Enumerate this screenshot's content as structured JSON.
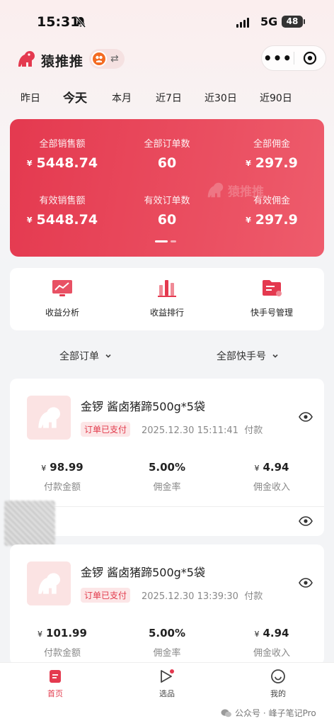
{
  "status_bar": {
    "time": "15:31",
    "network": "5G",
    "battery": "48"
  },
  "app": {
    "name": "猿推推"
  },
  "date_tabs": [
    {
      "label": "昨日"
    },
    {
      "label": "今天",
      "active": true
    },
    {
      "label": "本月"
    },
    {
      "label": "近7日"
    },
    {
      "label": "近30日"
    },
    {
      "label": "近90日"
    }
  ],
  "summary": {
    "currency": "¥",
    "watermark": "猿推推",
    "total_sales_label": "全部销售额",
    "total_sales": "5448.74",
    "total_orders_label": "全部订单数",
    "total_orders": "60",
    "total_commission_label": "全部佣金",
    "total_commission": "297.9",
    "valid_sales_label": "有效销售额",
    "valid_sales": "5448.74",
    "valid_orders_label": "有效订单数",
    "valid_orders": "60",
    "valid_commission_label": "有效佣金",
    "valid_commission": "297.9"
  },
  "quick_menu": [
    {
      "label": "收益分析",
      "icon": "chart-line-icon"
    },
    {
      "label": "收益排行",
      "icon": "bar-chart-icon"
    },
    {
      "label": "快手号管理",
      "icon": "folder-icon"
    }
  ],
  "filters": {
    "orders": "全部订单",
    "accounts": "全部快手号"
  },
  "orders": [
    {
      "title": "金锣 酱卤猪蹄500g*5袋",
      "status": "订单已支付",
      "time": "2025.12.30 15:11:41",
      "time_suffix": "付款",
      "amount": "98.99",
      "amount_label": "付款金额",
      "rate": "5.00",
      "rate_unit": "%",
      "rate_label": "佣金率",
      "commission": "4.94",
      "commission_label": "佣金收入"
    },
    {
      "title": "金锣 酱卤猪蹄500g*5袋",
      "status": "订单已支付",
      "time": "2025.12.30 13:39:30",
      "time_suffix": "付款",
      "amount": "101.99",
      "amount_label": "付款金额",
      "rate": "5.00",
      "rate_unit": "%",
      "rate_label": "佣金率",
      "commission": "4.94",
      "commission_label": "佣金收入"
    }
  ],
  "bottom_nav": [
    {
      "label": "首页",
      "icon": "home-doc-icon",
      "active": true
    },
    {
      "label": "选品",
      "icon": "play-icon"
    },
    {
      "label": "我的",
      "icon": "smile-icon"
    }
  ],
  "watermark_footer": {
    "prefix": "公众号 · ",
    "name": "峰子笔记Pro"
  },
  "colors": {
    "brand_red": "#e4394f",
    "badge_bg": "#fce6e7"
  }
}
